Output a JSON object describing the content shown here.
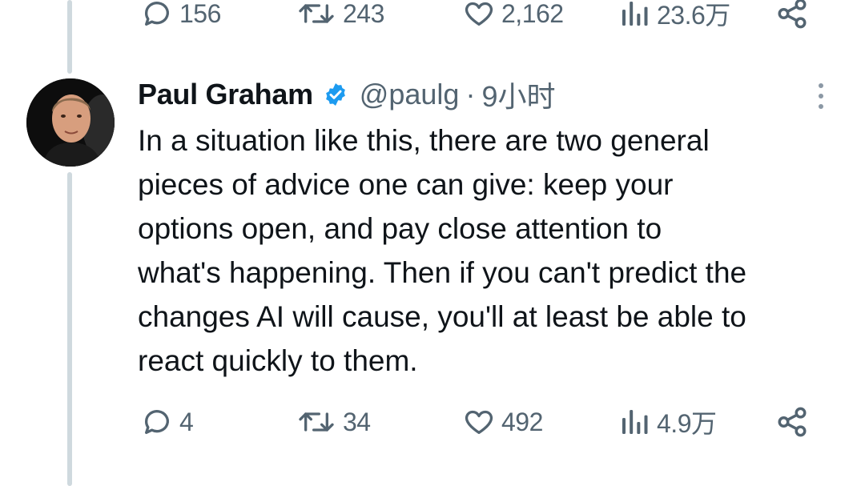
{
  "previous_tweet": {
    "actions": {
      "replies": "156",
      "retweets": "243",
      "likes": "2,162",
      "views": "23.6万"
    }
  },
  "tweet": {
    "author_name": "Paul Graham",
    "handle": "@paulg",
    "separator": "·",
    "time": "9小时",
    "text_lines": [
      "In a situation like this, there are two general",
      "pieces of advice one can give: keep your",
      "options open, and pay close attention to",
      "what's happening. Then if you can't predict the",
      "changes AI will cause, you'll at least be able to",
      "react quickly to them."
    ],
    "actions": {
      "replies": "4",
      "retweets": "34",
      "likes": "492",
      "views": "4.9万"
    }
  },
  "icons": {
    "reply": "speech-bubble-icon",
    "retweet": "retweet-arrows-icon",
    "like": "heart-icon",
    "views": "bar-chart-icon",
    "share": "share-nodes-icon",
    "verified": "verified-badge-icon",
    "more": "vertical-ellipsis-icon"
  },
  "colors": {
    "text_primary": "#0f1419",
    "text_secondary": "#536471",
    "verified_blue": "#1d9bf0",
    "thread_line": "#cfd9de"
  }
}
